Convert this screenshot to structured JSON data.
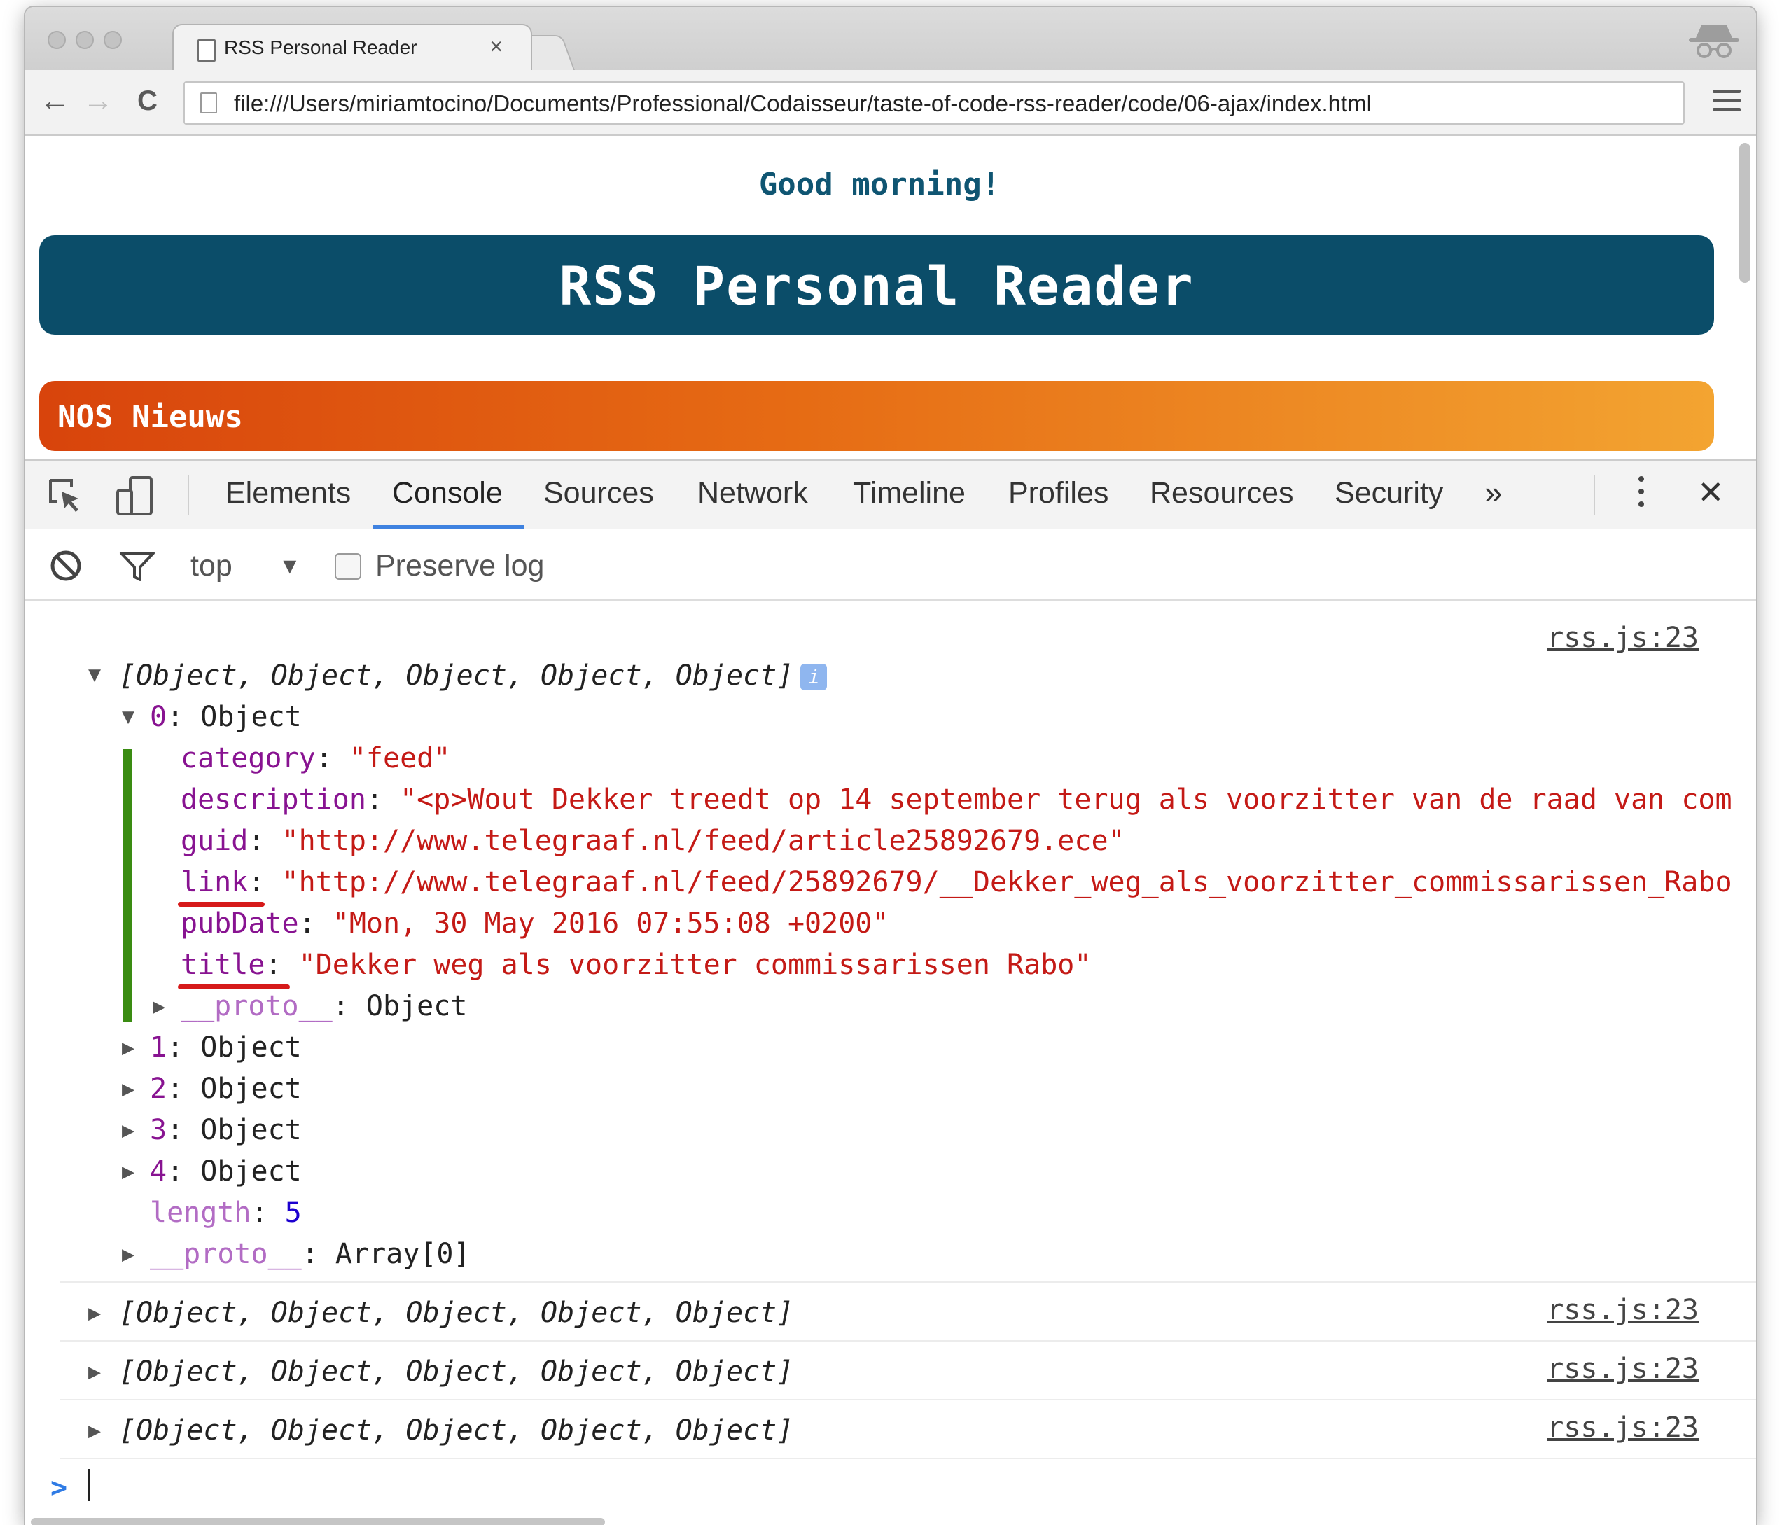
{
  "browser": {
    "tab_title": "RSS Personal Reader",
    "tab_close": "×",
    "url": "file:///Users/miriamtocino/Documents/Professional/Codaisseur/taste-of-code-rss-reader/code/06-ajax/index.html",
    "nav": {
      "back": "←",
      "forward": "→",
      "reload": "C"
    }
  },
  "page": {
    "greeting": "Good morning!",
    "banner_title": "RSS Personal Reader",
    "feed_title": "NOS Nieuws",
    "colors": {
      "banner": "#0b4d69",
      "feed_start": "#d8440c",
      "feed_end": "#f3a431",
      "greeting": "#0f5572"
    }
  },
  "devtools": {
    "tabs": [
      "Elements",
      "Console",
      "Sources",
      "Network",
      "Timeline",
      "Profiles",
      "Resources",
      "Security"
    ],
    "active_tab": "Console",
    "more": "»",
    "close": "✕",
    "filter": {
      "context": "top",
      "context_arrow": "▼",
      "preserve_log": "Preserve log",
      "preserve_log_checked": false
    }
  },
  "console": {
    "entries": [
      {
        "summary": "[Object, Object, Object, Object, Object]",
        "source": "rss.js:23",
        "expanded": true,
        "info_badge": "i"
      },
      {
        "summary": "[Object, Object, Object, Object, Object]",
        "source": "rss.js:23",
        "expanded": false
      },
      {
        "summary": "[Object, Object, Object, Object, Object]",
        "source": "rss.js:23",
        "expanded": false
      },
      {
        "summary": "[Object, Object, Object, Object, Object]",
        "source": "rss.js:23",
        "expanded": false
      }
    ],
    "expanded_item": {
      "key": "0",
      "type": "Object",
      "props": [
        {
          "key": "category",
          "value": "\"feed\""
        },
        {
          "key": "description",
          "value": "\"<p>Wout Dekker treedt op 14 september terug als voorzitter van de raad van com"
        },
        {
          "key": "guid",
          "value": "\"http://www.telegraaf.nl/feed/article25892679.ece\""
        },
        {
          "key": "link",
          "value": "\"http://www.telegraaf.nl/feed/25892679/__Dekker_weg_als_voorzitter_commissarissen_Rabo"
        },
        {
          "key": "pubDate",
          "value": "\"Mon, 30 May 2016 07:55:08 +0200\""
        },
        {
          "key": "title",
          "value": "\"Dekker weg als voorzitter commissarissen Rabo\""
        }
      ],
      "proto": {
        "key": "__proto__",
        "value": "Object"
      }
    },
    "collapsed_items": [
      {
        "key": "1",
        "value": "Object"
      },
      {
        "key": "2",
        "value": "Object"
      },
      {
        "key": "3",
        "value": "Object"
      },
      {
        "key": "4",
        "value": "Object"
      }
    ],
    "length": {
      "key": "length",
      "value": "5"
    },
    "array_proto": {
      "key": "__proto__",
      "value": "Array[0]"
    },
    "prompt": ">"
  }
}
